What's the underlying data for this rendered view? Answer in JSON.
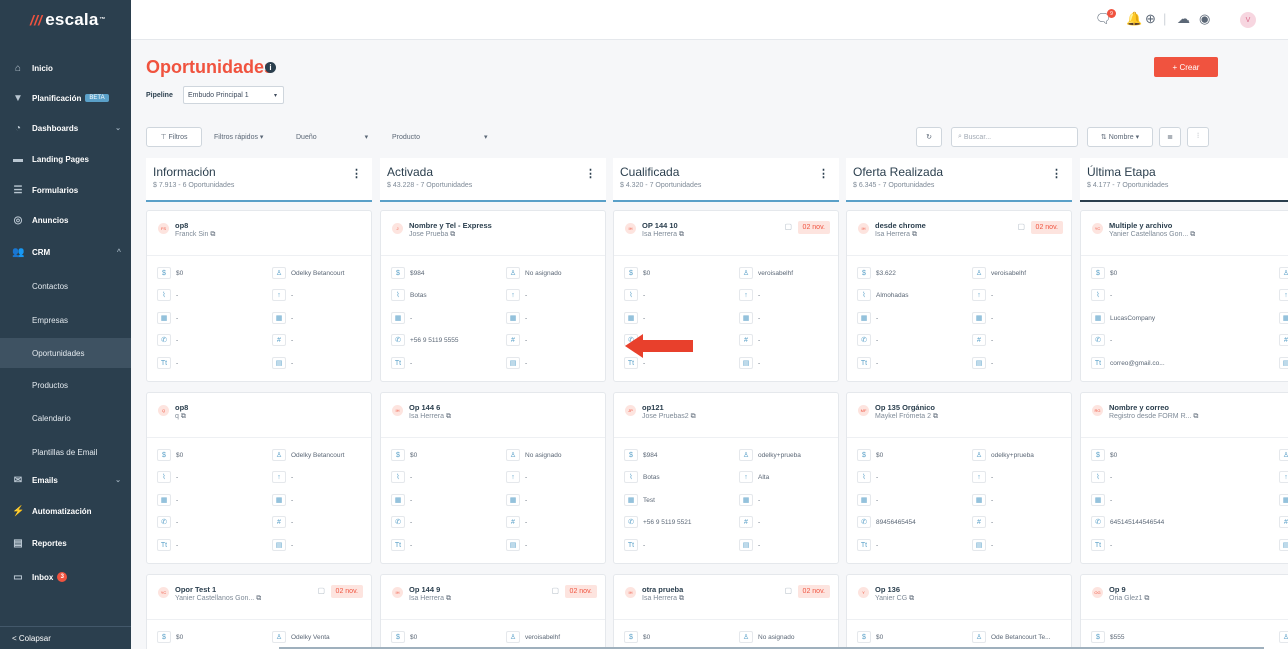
{
  "brand": {
    "name": "escala"
  },
  "nav": [
    {
      "label": "Inicio",
      "icon": "home-icon",
      "glyph": "⌂"
    },
    {
      "label": "Planificación",
      "icon": "filter-icon",
      "glyph": "▼",
      "badge": "BETA"
    },
    {
      "label": "Dashboards",
      "icon": "pie-chart-icon",
      "glyph": "◔",
      "chev": "⌄"
    },
    {
      "label": "Landing Pages",
      "icon": "window-icon",
      "glyph": "▬"
    },
    {
      "label": "Formularios",
      "icon": "form-icon",
      "glyph": "☰"
    },
    {
      "label": "Anuncios",
      "icon": "target-icon",
      "glyph": "◎"
    },
    {
      "label": "CRM",
      "icon": "users-icon",
      "glyph": "👥",
      "chev": "^"
    }
  ],
  "crm_sub": [
    "Contactos",
    "Empresas",
    "Oportunidades",
    "Productos",
    "Calendario",
    "Plantillas de Email"
  ],
  "nav2": [
    {
      "label": "Emails",
      "icon": "mail-icon",
      "glyph": "✉",
      "chev": "⌄"
    },
    {
      "label": "Automatización",
      "icon": "bolt-icon",
      "glyph": "⚡"
    },
    {
      "label": "Reportes",
      "icon": "report-icon",
      "glyph": "▤"
    },
    {
      "label": "Inbox",
      "icon": "inbox-icon",
      "glyph": "▭",
      "badge": "3"
    }
  ],
  "collapse": "< Colapsar",
  "topbar": {
    "chat_badge": "9",
    "avatar": "V"
  },
  "page": {
    "title": "Oportunidades",
    "create": "+ Crear",
    "pipeline_label": "Pipeline",
    "pipeline_value": "Embudo Principal 1"
  },
  "filters": {
    "filtros": "Filtros",
    "rapidos": "Filtros rápidos",
    "dueno": "Dueño",
    "producto": "Producto",
    "search_placeholder": "Buscar...",
    "sort": "Nombre"
  },
  "columns": [
    {
      "title": "Información",
      "sub": "$ 7.913 - 6 Oportunidades"
    },
    {
      "title": "Activada",
      "sub": "$ 43.228 - 7 Oportunidades"
    },
    {
      "title": "Cualificada",
      "sub": "$ 4.320 - 7 Oportunidades"
    },
    {
      "title": "Oferta Realizada",
      "sub": "$ 6.345 - 7 Oportunidades"
    },
    {
      "title": "Última Etapa",
      "sub": "$ 4.177 - 7 Oportunidades"
    }
  ],
  "cards": [
    [
      {
        "av": "FS",
        "name": "op8",
        "sub": "Franck Sin",
        "amount": "$0",
        "owner": "Odelky Betancourt",
        "product": "-",
        "stage": "-",
        "company": "-",
        "company2": "-",
        "phone": "-",
        "hash": "-",
        "tt": "-",
        "tbl": "-"
      },
      {
        "av": "Q",
        "name": "op8",
        "sub": "q",
        "amount": "$0",
        "owner": "Odelky Betancourt",
        "product": "-",
        "stage": "-",
        "company": "-",
        "company2": "-",
        "phone": "-",
        "hash": "-",
        "tt": "-",
        "tbl": "-"
      },
      {
        "av": "YC",
        "name": "Opor Test 1",
        "sub": "Yanier Castellanos Gon...",
        "date": "02 nov.",
        "amount": "$0",
        "owner": "Odelky Venta"
      }
    ],
    [
      {
        "av": "J",
        "name": "Nombre y Tel - Express",
        "sub": "Jose Prueba",
        "amount": "$984",
        "owner": "No asignado",
        "product": "Botas",
        "stage": "-",
        "company": "-",
        "company2": "-",
        "phone": "+56 9 5119 5555",
        "hash": "-",
        "tt": "-",
        "tbl": "-"
      },
      {
        "av": "IH",
        "name": "Op 144 6",
        "sub": "Isa Herrera",
        "amount": "$0",
        "owner": "No asignado",
        "product": "-",
        "stage": "-",
        "company": "-",
        "company2": "-",
        "phone": "-",
        "hash": "-",
        "tt": "-",
        "tbl": "-"
      },
      {
        "av": "IH",
        "name": "Op 144 9",
        "sub": "Isa Herrera",
        "date": "02 nov.",
        "amount": "$0",
        "owner": "veroisabelhf"
      }
    ],
    [
      {
        "av": "IH",
        "name": "OP 144 10",
        "sub": "Isa Herrera",
        "date": "02 nov.",
        "amount": "$0",
        "owner": "veroisabelhf",
        "product": "-",
        "stage": "-",
        "company": "-",
        "company2": "-",
        "phone": "-",
        "hash": "-",
        "tt": "-",
        "tbl": "-"
      },
      {
        "av": "JP",
        "name": "op121",
        "sub": "Jose Pruebas2",
        "amount": "$984",
        "owner": "odelky+prueba",
        "product": "Botas",
        "stage": "Alta",
        "company": "Test",
        "company2": "-",
        "phone": "+56 9 5119 5521",
        "hash": "-",
        "tt": "-",
        "tbl": "-"
      },
      {
        "av": "IH",
        "name": "otra prueba",
        "sub": "Isa Herrera",
        "date": "02 nov.",
        "amount": "$0",
        "owner": "No asignado"
      }
    ],
    [
      {
        "av": "IH",
        "name": "desde chrome",
        "sub": "Isa Herrera",
        "date": "02 nov.",
        "amount": "$3.622",
        "owner": "veroisabelhf",
        "product": "Almohadas",
        "stage": "-",
        "company": "-",
        "company2": "-",
        "phone": "-",
        "hash": "-",
        "tt": "-",
        "tbl": "-"
      },
      {
        "av": "MF",
        "name": "Op 135 Orgánico",
        "sub": "Maykel Frómeta 2",
        "amount": "$0",
        "owner": "odelky+prueba",
        "product": "-",
        "stage": "-",
        "company": "-",
        "company2": "-",
        "phone": "89456465454",
        "hash": "-",
        "tt": "-",
        "tbl": "-"
      },
      {
        "av": "Y",
        "name": "Op 136",
        "sub": "Yanier CG",
        "amount": "$0",
        "owner": "Ode Betancourt Te..."
      }
    ],
    [
      {
        "av": "YC",
        "name": "Multiple y archivo",
        "sub": "Yanier Castellanos Gon...",
        "amount": "$0",
        "owner": "",
        "product": "-",
        "stage": "",
        "company": "LucasCompany",
        "company2": "",
        "phone": "-",
        "hash": "",
        "tt": "correo@gmail.co...",
        "tbl": ""
      },
      {
        "av": "RG",
        "name": "Nombre y correo",
        "sub": "Registro desde FORM R...",
        "amount": "$0",
        "owner": "",
        "product": "-",
        "stage": "",
        "company": "-",
        "company2": "",
        "phone": "645145144546544",
        "hash": "",
        "tt": "-",
        "tbl": ""
      },
      {
        "av": "OG",
        "name": "Op 9",
        "sub": "Oria Glez1",
        "amount": "$555",
        "owner": ""
      }
    ]
  ]
}
